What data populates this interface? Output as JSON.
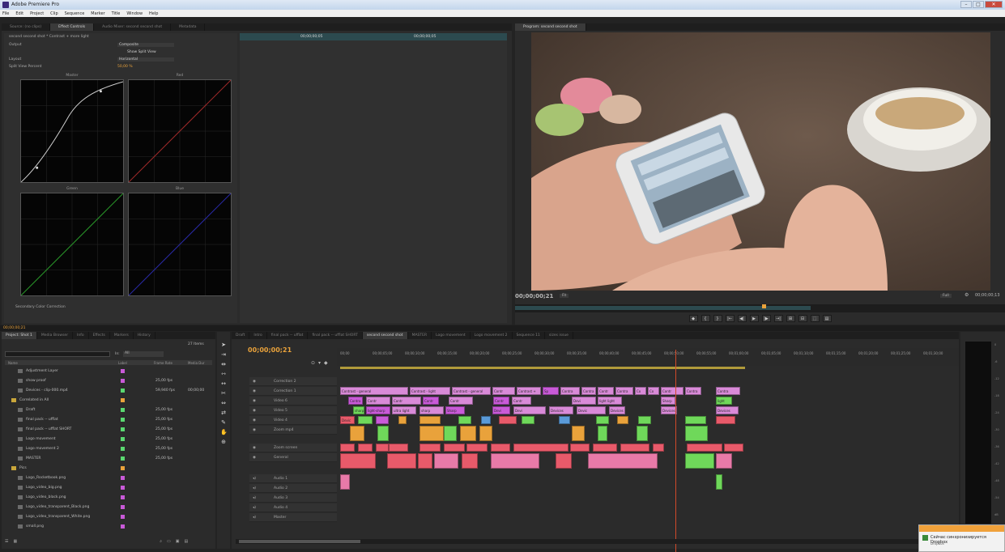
{
  "window": {
    "title": "Adobe Premiere Pro",
    "controls": [
      "–",
      "□",
      "✕"
    ]
  },
  "menu": [
    "File",
    "Edit",
    "Project",
    "Clip",
    "Sequence",
    "Marker",
    "Title",
    "Window",
    "Help"
  ],
  "effect_panel": {
    "tabs": [
      "Source: (no clips)",
      "Effect Controls",
      "Audio Mixer: second second shot",
      "Metadata"
    ],
    "header": "second second shot * Contrast + more light",
    "rows": [
      {
        "label": "Output",
        "value": "Composite"
      },
      {
        "label": "",
        "value": "Show Split View"
      },
      {
        "label": "Layout",
        "value": "Horizontal"
      },
      {
        "label": "Split View Percent",
        "value": "50,00 %"
      }
    ],
    "curves": [
      "Master",
      "Red",
      "Green",
      "Blue"
    ],
    "footer": "Secondary Color Correction",
    "ruler": [
      "00;00;00;05",
      "00;00;00;05"
    ]
  },
  "program": {
    "tab": "Program: second second shot",
    "timecode": "00;00;00;21",
    "fit": "Fit",
    "full": "Full",
    "duration": "00;00;00;13",
    "transport": [
      "◆",
      "{",
      "}",
      "|←",
      "◀|",
      "▶",
      "|▶",
      "→|",
      "⊞",
      "⊟",
      "⬚",
      "▤"
    ]
  },
  "status_bar": {
    "timecode": "00;00;00;21"
  },
  "project": {
    "tabs": [
      "Project: Shot 1",
      "Media Browser",
      "Info",
      "Effects",
      "Markers",
      "History"
    ],
    "item_count": "27 Items",
    "in_label": "In:",
    "in_value": "All",
    "columns": [
      "Name",
      "Label",
      "Frame Rate",
      "Media Dur"
    ],
    "items": [
      {
        "name": "Adjustment Layer",
        "color": "#c95ad8",
        "fps": "",
        "dur": ""
      },
      {
        "name": "show proof",
        "color": "#c95ad8",
        "fps": "25,00 fps",
        "dur": ""
      },
      {
        "name": "Devices - clip-000.mp4",
        "color": "#5ad870",
        "fps": "59,940 fps",
        "dur": "00;00;00"
      },
      {
        "name": "Correlated in All",
        "color": "#e9a23b",
        "fps": "",
        "dur": ""
      },
      {
        "name": "Draft",
        "color": "#5ad870",
        "fps": "25,00 fps",
        "dur": ""
      },
      {
        "name": "final pack -- ufflat",
        "color": "#5ad870",
        "fps": "25,00 fps",
        "dur": ""
      },
      {
        "name": "final pack -- ufflat SHORT",
        "color": "#5ad870",
        "fps": "25,00 fps",
        "dur": ""
      },
      {
        "name": "Logo movement",
        "color": "#5ad870",
        "fps": "25,00 fps",
        "dur": ""
      },
      {
        "name": "Logo movement 2",
        "color": "#5ad870",
        "fps": "25,00 fps",
        "dur": ""
      },
      {
        "name": "MASTER",
        "color": "#5ad870",
        "fps": "25,00 fps",
        "dur": ""
      },
      {
        "name": "Pics",
        "color": "#e9a23b",
        "fps": "",
        "dur": ""
      },
      {
        "name": "Logo_Rocketbook.png",
        "color": "#c95ad8",
        "fps": "",
        "dur": ""
      },
      {
        "name": "Logo_video_big.png",
        "color": "#c95ad8",
        "fps": "",
        "dur": ""
      },
      {
        "name": "Logo_video_black.png",
        "color": "#c95ad8",
        "fps": "",
        "dur": ""
      },
      {
        "name": "Logo_video_transparent_Black.png",
        "color": "#c95ad8",
        "fps": "",
        "dur": ""
      },
      {
        "name": "Logo_video_transparent_White.png",
        "color": "#c95ad8",
        "fps": "",
        "dur": ""
      },
      {
        "name": "small.png",
        "color": "#c95ad8",
        "fps": "",
        "dur": ""
      }
    ]
  },
  "timeline": {
    "tabs": [
      "Draft",
      "Intro",
      "final pack -- ufflat",
      "final pack -- ufflat SHORT",
      "second second shot",
      "MASTER",
      "Logo movement",
      "Logo movement 2",
      "Sequence 11",
      "sizes issue"
    ],
    "active_tab": 4,
    "timecode": "00;00;00;21",
    "ruler": [
      "00;00",
      "00;00;05;00",
      "00;00;10;00",
      "00;00;15;00",
      "00;00;20;00",
      "00;00;25;00",
      "00;00;30;00",
      "00;00;35;00",
      "00;00;40;00",
      "00;00;45;00",
      "00;00;50;00",
      "00;00;55;00",
      "00;01;00;00",
      "00;01;05;00",
      "00;01;10;00",
      "00;01;15;00",
      "00;01;20;00",
      "00;01;25;00",
      "00;01;30;00"
    ],
    "tracks": [
      "Correction 2",
      "Correction 1",
      "Video 6",
      "Video 5",
      "Video 4",
      "Zoom mp4",
      "Zoom screen",
      "General",
      "Audio 1",
      "Audio 2",
      "Audio 3",
      "Audio 4",
      "Master"
    ],
    "clip_labels": [
      "Contrast - general",
      "Contrast - light",
      "Contrast - general",
      "Contr",
      "Contrast +",
      "Sp",
      "Contra",
      "Contra",
      "Contr",
      "Contra",
      "Co",
      "Co",
      "Contr",
      "Contra",
      "Contra",
      "Contra",
      "Contr",
      "Contr",
      "Contr",
      "Contr",
      "Contr",
      "Contr",
      "Devi",
      "light light",
      "Sharp",
      "light",
      "sharpe",
      "light-sharp",
      "ultra light",
      "sharp",
      "Sharp",
      "Devi",
      "Devi",
      "Devices",
      "Devic",
      "Devices",
      "Devices",
      "Devices",
      "Devic"
    ]
  },
  "meter": {
    "ticks": [
      "0",
      "-6",
      "-12",
      "-18",
      "-24",
      "-30",
      "-36",
      "-42",
      "-48",
      "-54",
      "dB"
    ]
  },
  "notification": {
    "title": "Сейчас синхронизируется Dropbox",
    "sub": "Dropbox"
  }
}
